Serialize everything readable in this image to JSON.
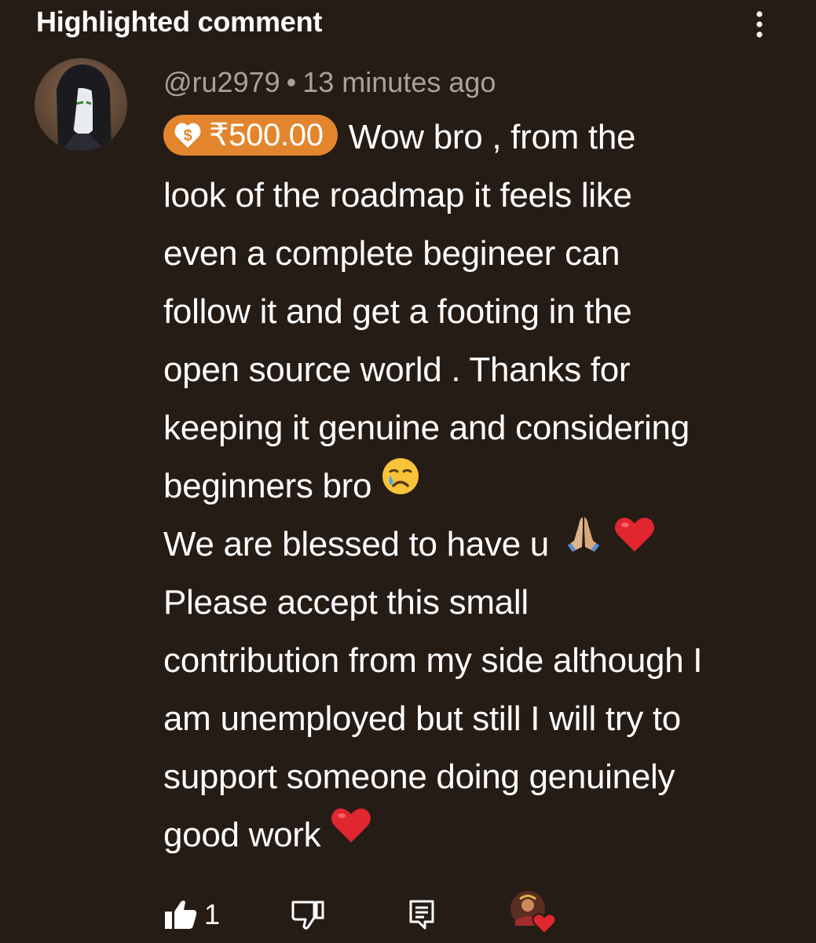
{
  "header": {
    "title": "Highlighted comment",
    "menu_icon": "more-vertical-icon"
  },
  "comment": {
    "author": "@ru2979",
    "separator": "•",
    "time": "13 minutes ago",
    "superchat": {
      "icon": "super-thanks-icon",
      "amount": "₹500.00",
      "color": "#e2852d"
    },
    "lines": [
      "Wow bro , from the",
      "look of the roadmap it feels like",
      "even a complete begineer can",
      "follow it and get a footing in the",
      "open source world . Thanks for",
      "keeping it genuine and considering",
      "beginners bro",
      "We are blessed to have u",
      "Please accept this small",
      "contribution from my side although I",
      "am unemployed but still I will try to",
      "support someone doing genuinely",
      "good work"
    ]
  },
  "actions": {
    "like_icon": "thumbs-up-icon",
    "like_count": "1",
    "dislike_icon": "thumbs-down-icon",
    "reply_icon": "reply-comment-icon",
    "creator_heart_icon": "creator-heart-icon"
  },
  "colors": {
    "background": "#251c16",
    "meta_text": "#a8a29c",
    "superchat": "#e2852d"
  }
}
